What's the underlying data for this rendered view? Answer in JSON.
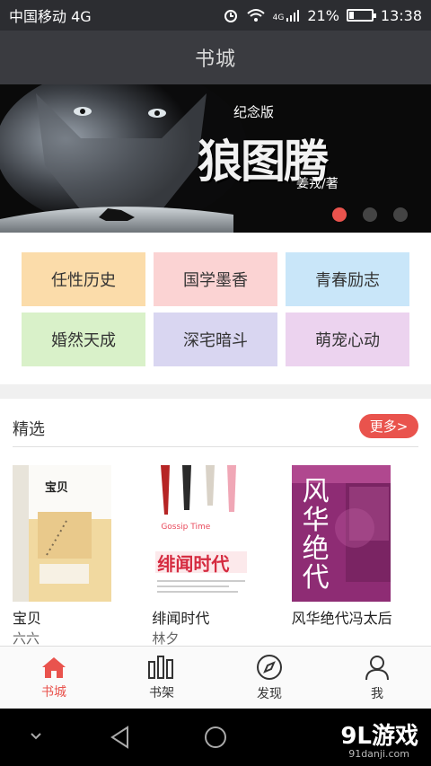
{
  "status_bar": {
    "carrier": "中国移动 4G",
    "network_badge": "4G",
    "battery_text": "21%",
    "battery_level": 0.21,
    "time": "13:38",
    "icons": [
      "alarm-icon",
      "wifi-icon",
      "signal-icon",
      "battery-icon"
    ]
  },
  "header": {
    "title": "书城"
  },
  "banner": {
    "tagline": "纪念版",
    "title": "狼图腾",
    "author": "姜戎/著",
    "slide_count": 3,
    "active_slide": 0
  },
  "categories": [
    {
      "label": "任性历史",
      "color": "#fbdcaa"
    },
    {
      "label": "国学墨香",
      "color": "#fbd3d3"
    },
    {
      "label": "青春励志",
      "color": "#c9e6f9"
    },
    {
      "label": "婚然天成",
      "color": "#d9f1c9"
    },
    {
      "label": "深宅暗斗",
      "color": "#d9d6f1"
    },
    {
      "label": "萌宠心动",
      "color": "#ecd3ef"
    }
  ],
  "featured": {
    "title": "精选",
    "more_label": "更多>",
    "books": [
      {
        "title": "宝贝",
        "author": "六六",
        "cover_title": "宝贝",
        "cover_color": "#f3dca6"
      },
      {
        "title": "绯闻时代",
        "author": "林夕",
        "cover_title": "绯闻时代",
        "cover_color": "#ffffff"
      },
      {
        "title": "风华绝代冯太后",
        "author": "",
        "cover_title": "风华绝代",
        "cover_color": "#9a2f7d"
      }
    ]
  },
  "tabs": [
    {
      "label": "书城",
      "icon": "home-icon",
      "active": true
    },
    {
      "label": "书架",
      "icon": "bookshelf-icon",
      "active": false
    },
    {
      "label": "发现",
      "icon": "compass-icon",
      "active": false
    },
    {
      "label": "我",
      "icon": "user-icon",
      "active": false
    }
  ],
  "accent_color": "#e9534d",
  "watermark": {
    "brand": "9L游戏",
    "site": "91danji.com"
  }
}
